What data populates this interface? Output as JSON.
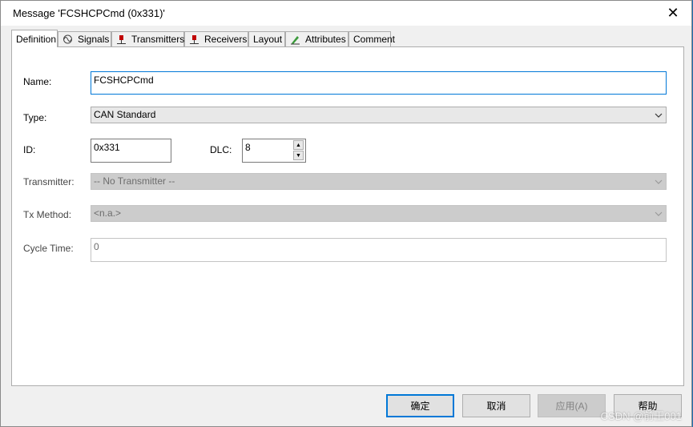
{
  "window": {
    "title": "Message 'FCSHCPCmd (0x331)'"
  },
  "tabs": [
    {
      "label": "Definition",
      "icon": "none",
      "active": true
    },
    {
      "label": "Signals",
      "icon": "signal-waveform-icon"
    },
    {
      "label": "Transmitters",
      "icon": "transmitter-icon"
    },
    {
      "label": "Receivers",
      "icon": "receiver-icon"
    },
    {
      "label": "Layout",
      "icon": "none"
    },
    {
      "label": "Attributes",
      "icon": "attributes-pen-icon"
    },
    {
      "label": "Comment",
      "icon": "none"
    }
  ],
  "form": {
    "name_label": "Name:",
    "name_value": "FCSHCPCmd",
    "type_label": "Type:",
    "type_value": "CAN Standard",
    "id_label": "ID:",
    "id_value": "0x331",
    "dlc_label": "DLC:",
    "dlc_value": "8",
    "transmitter_label": "Transmitter:",
    "transmitter_value": "-- No Transmitter --",
    "tx_method_label": "Tx Method:",
    "tx_method_value": "<n.a.>",
    "cycle_time_label": "Cycle Time:",
    "cycle_time_value": "0"
  },
  "buttons": {
    "ok": "确定",
    "cancel": "取消",
    "apply": "应用(A)",
    "help": "帮助"
  },
  "watermark": "CSDN @前王001",
  "colors": {
    "accent": "#0078d7",
    "desktop": "#1f6fb2",
    "disabled": "#cccccc"
  }
}
